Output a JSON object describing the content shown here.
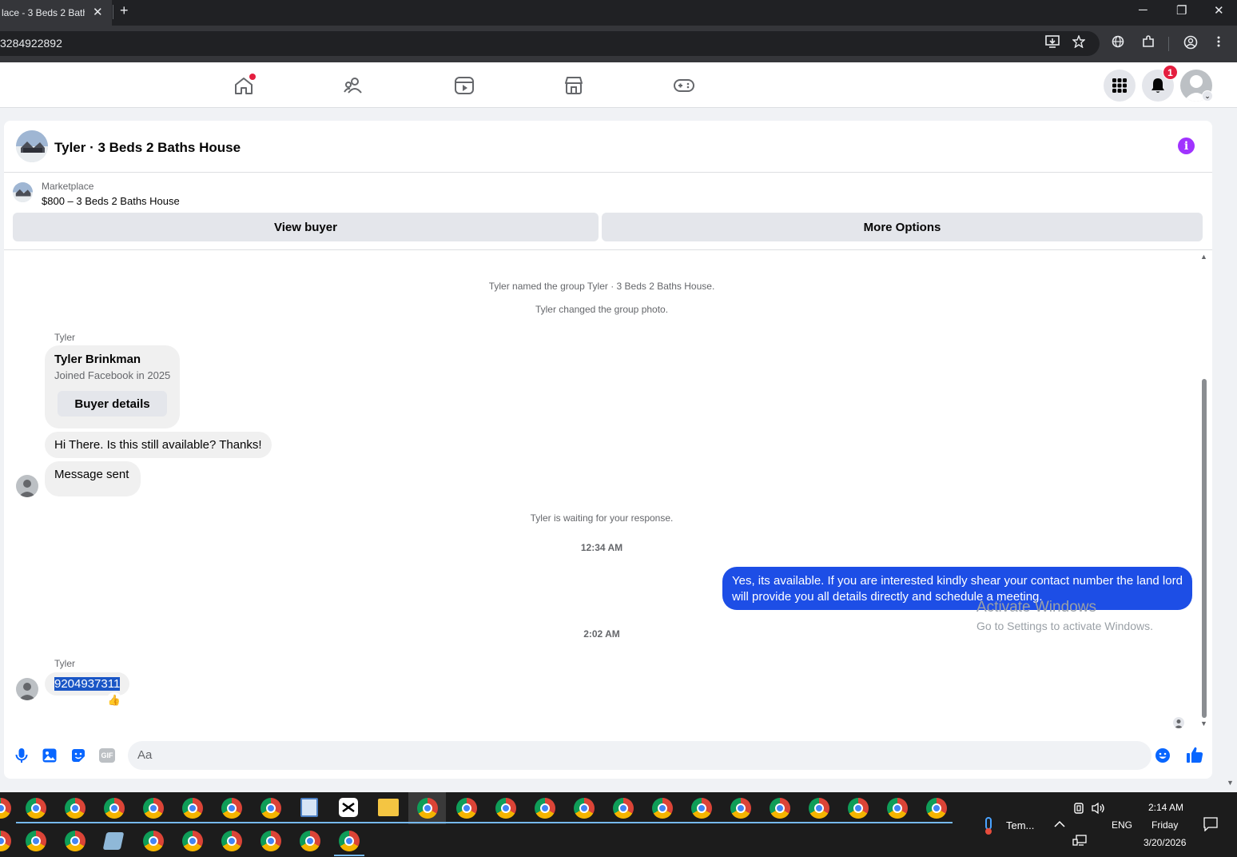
{
  "browser": {
    "tab_title": "lace - 3 Beds 2 Bath",
    "tab_close": "✕",
    "new_tab": "+",
    "url": "3284922892",
    "win_min": "─",
    "win_restore": "❐",
    "win_close": "✕"
  },
  "fb_nav": {
    "notification_count": "1"
  },
  "chat": {
    "title": "Tyler · 3 Beds 2 Baths House",
    "marketplace_label": "Marketplace",
    "listing": "$800 – 3 Beds 2 Baths House",
    "view_buyer_label": "View buyer",
    "more_options_label": "More Options",
    "system_messages": [
      "Tyler named the group Tyler · 3 Beds 2 Baths House.",
      "Tyler changed the group photo."
    ],
    "sender_name": "Tyler",
    "buyer_card": {
      "name": "Tyler Brinkman",
      "joined": "Joined Facebook in 2025",
      "button": "Buyer details"
    },
    "msg_available": "Hi There. Is this still available? Thanks!",
    "msg_sent": "Message sent",
    "waiting": "Tyler is waiting for your response.",
    "time1": "12:34 AM",
    "my_reply": "Yes, its available. If you are interested kindly shear your contact number the land lord will provide you all details directly and schedule a meeting.",
    "time2": "2:02 AM",
    "sender_name2": "Tyler",
    "phone": "9204937311",
    "reaction": "👍",
    "composer_placeholder": "Aa",
    "gif_label": "GIF"
  },
  "watermark": {
    "line1": "Activate Windows",
    "line2": "Go to Settings to activate Windows."
  },
  "taskbar": {
    "weather": "Tem...",
    "lang": "ENG",
    "time": "2:14 AM",
    "day": "Friday",
    "date": "3/20/2026"
  },
  "colors": {
    "accent_blue": "#0866ff",
    "my_bubble": "#1d4ee6",
    "info_purple": "#a033ff",
    "badge_red": "#e41e3f"
  }
}
